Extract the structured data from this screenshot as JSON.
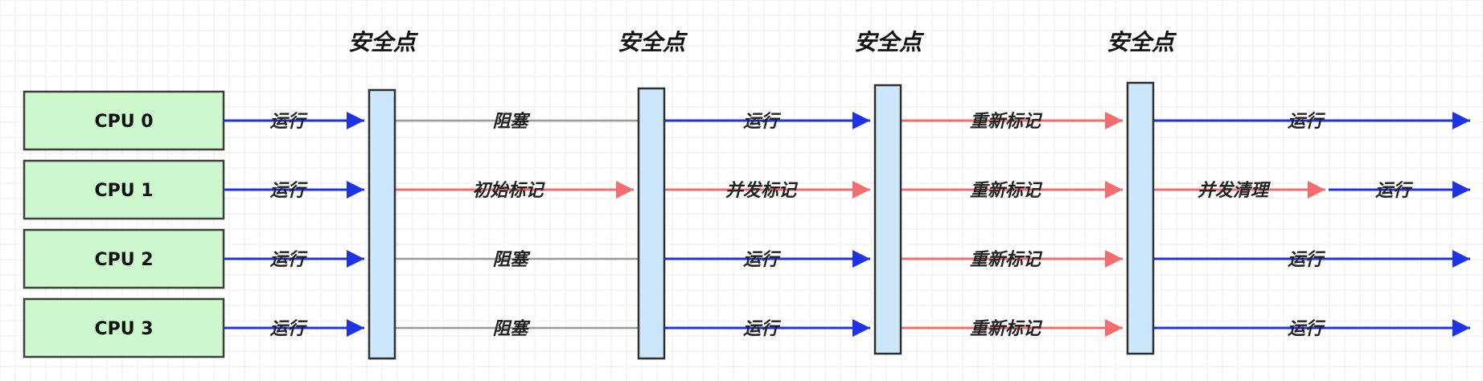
{
  "colors": {
    "run": "#1f33e6",
    "block": "#9a9a9a",
    "mark": "#f26d6d",
    "cpu_fill": "#cdf7cd",
    "bar_fill": "#cce6fb"
  },
  "safepoint_label": "安全点",
  "safepoints": [
    "安全点",
    "安全点",
    "安全点",
    "安全点"
  ],
  "cpus": [
    {
      "label": "CPU 0",
      "segments": [
        {
          "text": "运行",
          "type": "run"
        },
        {
          "text": "阻塞",
          "type": "block"
        },
        {
          "text": "运行",
          "type": "run"
        },
        {
          "text": "重新标记",
          "type": "mark"
        },
        {
          "text": "运行",
          "type": "run"
        }
      ]
    },
    {
      "label": "CPU 1",
      "segments": [
        {
          "text": "运行",
          "type": "run"
        },
        {
          "text": "初始标记",
          "type": "mark"
        },
        {
          "text": "并发标记",
          "type": "mark"
        },
        {
          "text": "重新标记",
          "type": "mark"
        },
        {
          "text": "并发清理",
          "type": "mark"
        },
        {
          "text": "运行",
          "type": "run"
        }
      ]
    },
    {
      "label": "CPU 2",
      "segments": [
        {
          "text": "运行",
          "type": "run"
        },
        {
          "text": "阻塞",
          "type": "block"
        },
        {
          "text": "运行",
          "type": "run"
        },
        {
          "text": "重新标记",
          "type": "mark"
        },
        {
          "text": "运行",
          "type": "run"
        }
      ]
    },
    {
      "label": "CPU 3",
      "segments": [
        {
          "text": "运行",
          "type": "run"
        },
        {
          "text": "阻塞",
          "type": "block"
        },
        {
          "text": "运行",
          "type": "run"
        },
        {
          "text": "重新标记",
          "type": "mark"
        },
        {
          "text": "运行",
          "type": "run"
        }
      ]
    }
  ]
}
